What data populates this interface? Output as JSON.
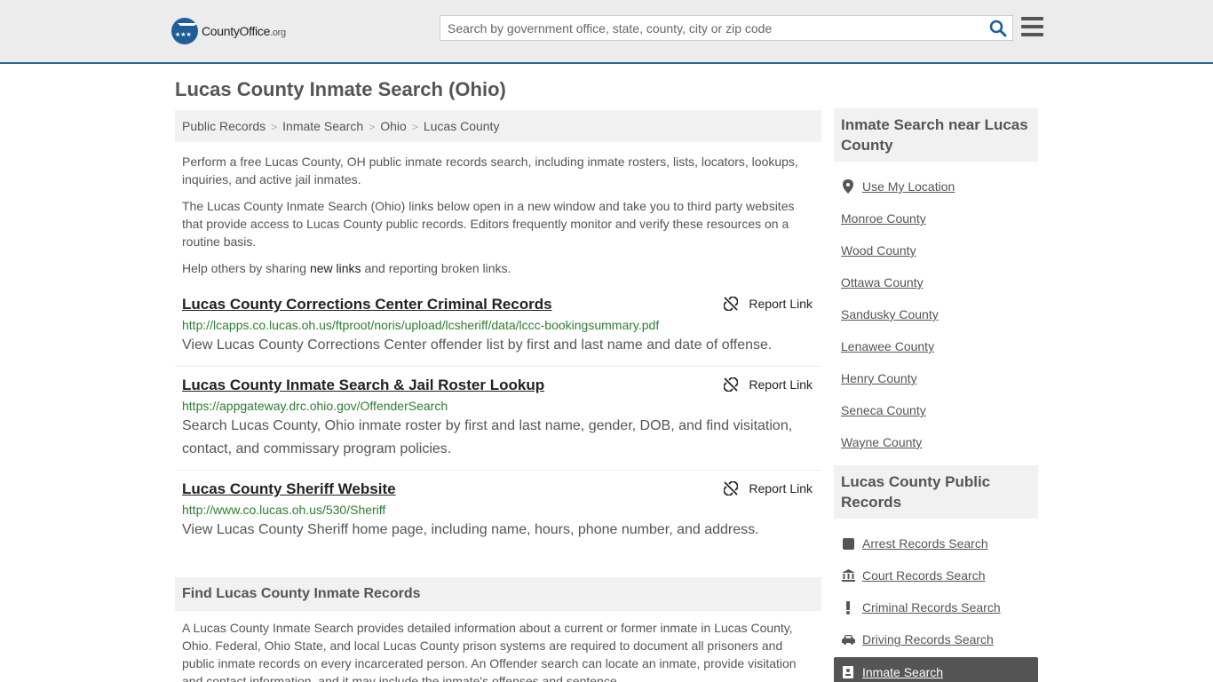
{
  "header": {
    "logo_main": "CountyOffice",
    "logo_tld": ".org",
    "search_placeholder": "Search by government office, state, county, city or zip code"
  },
  "page_title": "Lucas County Inmate Search (Ohio)",
  "breadcrumb": [
    "Public Records",
    "Inmate Search",
    "Ohio",
    "Lucas County"
  ],
  "intro": {
    "p1": "Perform a free Lucas County, OH public inmate records search, including inmate rosters, lists, locators, lookups, inquiries, and active jail inmates.",
    "p2": "The Lucas County Inmate Search (Ohio) links below open in a new window and take you to third party websites that provide access to Lucas County public records. Editors frequently monitor and verify these resources on a routine basis.",
    "p3_before": "Help others by sharing ",
    "p3_link": "new links",
    "p3_after": " and reporting broken links."
  },
  "results": [
    {
      "title": "Lucas County Corrections Center Criminal Records",
      "url": "http://lcapps.co.lucas.oh.us/ftproot/noris/upload/lcsheriff/data/lccc-bookingsummary.pdf",
      "desc": "View Lucas County Corrections Center offender list by first and last name and date of offense.",
      "report": "Report Link"
    },
    {
      "title": "Lucas County Inmate Search & Jail Roster Lookup",
      "url": "https://appgateway.drc.ohio.gov/OffenderSearch",
      "desc": "Search Lucas County, Ohio inmate roster by first and last name, gender, DOB, and find visitation, contact, and commissary program policies.",
      "report": "Report Link"
    },
    {
      "title": "Lucas County Sheriff Website",
      "url": "http://www.co.lucas.oh.us/530/Sheriff",
      "desc": "View Lucas County Sheriff home page, including name, hours, phone number, and address.",
      "report": "Report Link"
    }
  ],
  "find": {
    "heading": "Find Lucas County Inmate Records",
    "body": "A Lucas County Inmate Search provides detailed information about a current or former inmate in Lucas County, Ohio. Federal, Ohio State, and local Lucas County prison systems are required to document all prisoners and public inmate records on every incarcerated person. An Offender search can locate an inmate, provide visitation and contact information, and it may include the inmate's offenses and sentence."
  },
  "sidebar": {
    "near_heading": "Inmate Search near Lucas County",
    "use_location": "Use My Location",
    "near_counties": [
      "Monroe County",
      "Wood County",
      "Ottawa County",
      "Sandusky County",
      "Lenawee County",
      "Henry County",
      "Seneca County",
      "Wayne County"
    ],
    "records_heading": "Lucas County Public Records",
    "records_links": [
      {
        "label": "Arrest Records Search",
        "icon": "square-icon"
      },
      {
        "label": "Court Records Search",
        "icon": "courthouse-icon"
      },
      {
        "label": "Criminal Records Search",
        "icon": "exclamation-icon"
      },
      {
        "label": "Driving Records Search",
        "icon": "car-icon"
      }
    ],
    "active_item": "Inmate Search"
  }
}
